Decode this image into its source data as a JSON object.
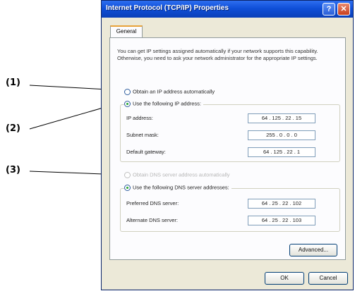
{
  "callouts": [
    "(1)",
    "(2)",
    "(3)"
  ],
  "window": {
    "title": "Internet Protocol (TCP/IP) Properties",
    "help": "?",
    "close": "✕"
  },
  "tabs": [
    {
      "label": "General"
    }
  ],
  "intro": "You can get IP settings assigned automatically if your network supports this capability. Otherwise, you need to ask your network administrator for the appropriate IP settings.",
  "ip_section": {
    "auto_label": "Obtain an IP address automatically",
    "manual_label": "Use the following IP address:",
    "fields": [
      {
        "label": "IP address:",
        "value": "64 . 125 . 22 . 15"
      },
      {
        "label": "Subnet mask:",
        "value": "255 . 0 . 0 . 0"
      },
      {
        "label": "Default gateway:",
        "value": "64 . 125 . 22 . 1"
      }
    ]
  },
  "dns_section": {
    "auto_label": "Obtain DNS server address automatically",
    "manual_label": "Use the following DNS server addresses:",
    "fields": [
      {
        "label": "Preferred DNS server:",
        "value": "64 . 25 . 22 . 102"
      },
      {
        "label": "Alternate DNS server:",
        "value": "64 . 25 . 22 . 103"
      }
    ]
  },
  "buttons": {
    "advanced": "Advanced...",
    "ok": "OK",
    "cancel": "Cancel"
  }
}
